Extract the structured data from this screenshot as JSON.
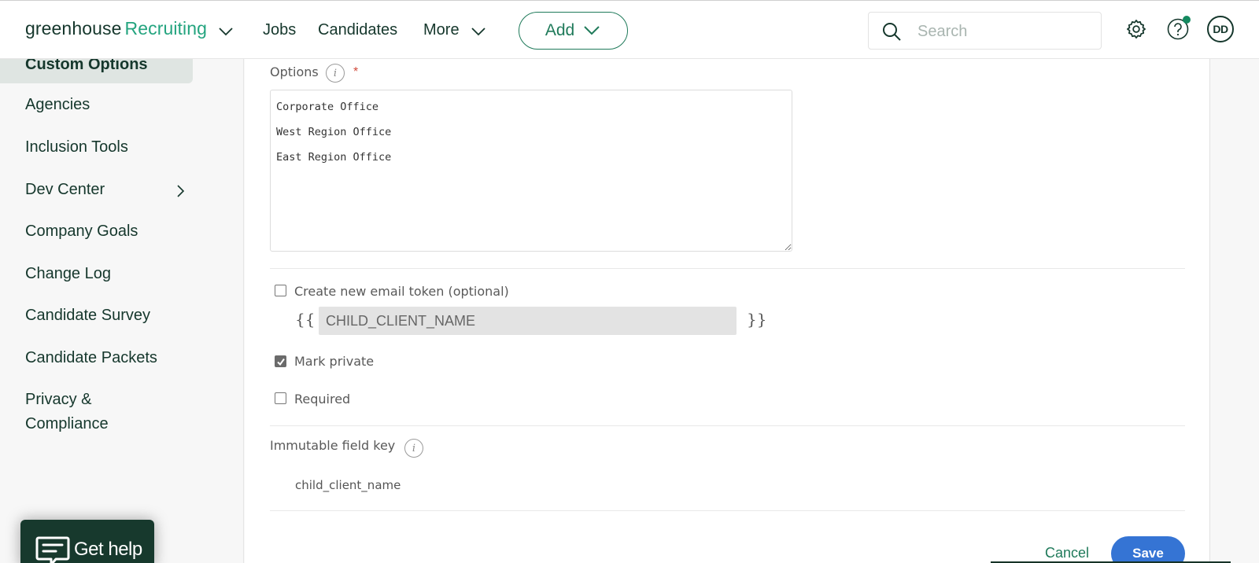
{
  "topnav": {
    "brand_primary": "greenhouse",
    "brand_secondary": "Recruiting",
    "links": [
      {
        "label": "Jobs"
      },
      {
        "label": "Candidates"
      },
      {
        "label": "More"
      }
    ],
    "add_label": "Add",
    "search_placeholder": "Search",
    "search_value": "",
    "icons": [
      "search-icon",
      "gear-icon",
      "help-icon"
    ],
    "avatar_initials": "DD",
    "notification_dot_color": "#13895f"
  },
  "sidebar": {
    "active_item": "Custom Options",
    "items": [
      {
        "label": "Agencies"
      },
      {
        "label": "Inclusion Tools"
      },
      {
        "label": "Dev Center",
        "has_submenu": true
      },
      {
        "label": "Company Goals"
      },
      {
        "label": "Change Log"
      },
      {
        "label": "Candidate Survey"
      },
      {
        "label": "Candidate Packets"
      },
      {
        "label": "Privacy &",
        "label_line2": "Compliance"
      }
    ],
    "get_help_label": "Get help"
  },
  "form": {
    "options_label": "Options",
    "options_required_marker": "*",
    "options_values": [
      "Corporate Office",
      "West Region Office",
      "East Region Office"
    ],
    "email_token": {
      "label": "Create new email token (optional)",
      "checked": false,
      "open_brace": "{{",
      "close_brace": "}}",
      "value": "CHILD_CLIENT_NAME"
    },
    "mark_private": {
      "label": "Mark private",
      "checked": true
    },
    "required": {
      "label": "Required",
      "checked": false
    },
    "immutable_key_label": "Immutable field key",
    "immutable_key_value": "child_client_name",
    "cancel_label": "Cancel",
    "save_label": "Save"
  },
  "colors": {
    "brand_green": "#24a47f",
    "dark_green": "#15372c",
    "accent_green": "#1f7a5a",
    "save_blue": "#3574d4",
    "required_red": "#d14b3c"
  }
}
